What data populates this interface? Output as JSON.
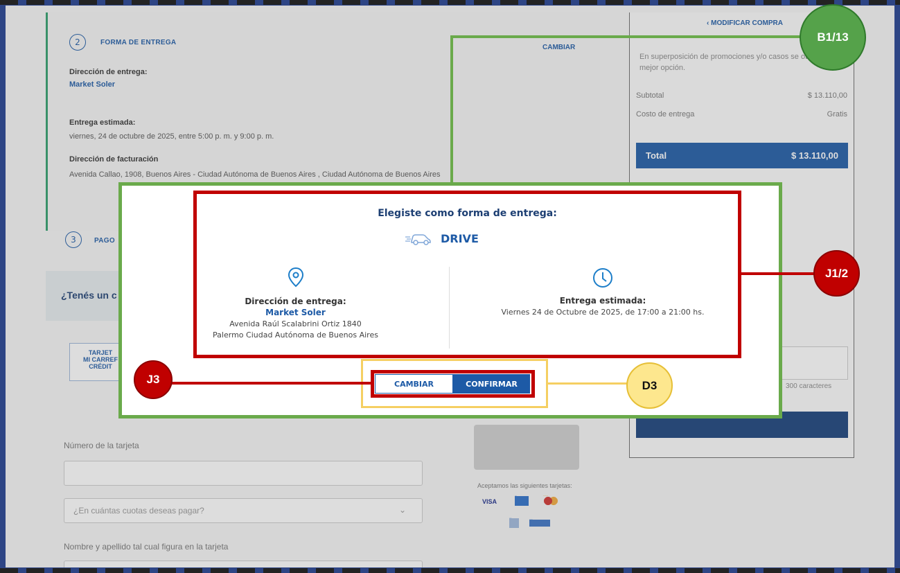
{
  "background_page": {
    "step2": {
      "number": "2",
      "title": "FORMA DE ENTREGA",
      "change_link": "CAMBIAR",
      "delivery_address_label": "Dirección de entrega:",
      "delivery_address_value": "Market Soler",
      "estimated_label": "Entrega estimada:",
      "estimated_value": "viernes, 24 de octubre de 2025, entre 5:00 p. m. y 9:00 p. m.",
      "billing_label": "Dirección de facturación",
      "billing_value": "Avenida Callao, 1908, Buenos Aires - Ciudad Autónoma de Buenos Aires , Ciudad Autónoma de Buenos Aires"
    },
    "step3": {
      "number": "3",
      "title": "PAGO"
    },
    "promo_question": "¿Tenés un c",
    "card_tab": [
      "TARJET",
      "MI CARREF",
      "CRÉDIT"
    ],
    "card_number_label": "Número de la tarjeta",
    "installments_placeholder": "¿En cuántas cuotas deseas pagar?",
    "name_label": "Nombre y apellido tal cual figura en la tarjeta",
    "accepted_cards": "Aceptamos las siguientes tarjetas:",
    "card_logos": [
      "VISA",
      "AMEX",
      "MASTERCARD",
      "CABAL",
      "NARANJA"
    ]
  },
  "summary": {
    "modify_label": "MODIFICAR COMPRA",
    "note": "En superposición de promociones y/o casos se otorgará la mejor opción.",
    "subtotal_label": "Subtotal",
    "subtotal_value": "$ 13.110,00",
    "delivery_cost_label": "Costo de entrega",
    "delivery_cost_value": "Gratis",
    "total_label": "Total",
    "total_value": "$ 13.110,00",
    "chars_note": "300 caracteres"
  },
  "modal": {
    "title": "Elegiste como forma de entrega:",
    "method": "DRIVE",
    "left": {
      "title": "Dirección de entrega:",
      "store": "Market Soler",
      "line1": "Avenida Raúl Scalabrini Ortiz 1840",
      "line2": "Palermo Ciudad Autónoma de Buenos Aires"
    },
    "right": {
      "title": "Entrega estimada:",
      "text": "Viernes 24 de Octubre de 2025, de 17:00 a 21:00 hs."
    },
    "btn_change": "CAMBIAR",
    "btn_confirm": "CONFIRMAR"
  },
  "annotations": {
    "green": "B1/13",
    "red_modal": "J1/2",
    "red_buttons": "J3",
    "yellow": "D3"
  },
  "colors": {
    "brand_blue": "#1d5aa6",
    "annotation_green": "#55a24a",
    "annotation_red": "#c00000",
    "annotation_yellow": "#fde78e"
  }
}
